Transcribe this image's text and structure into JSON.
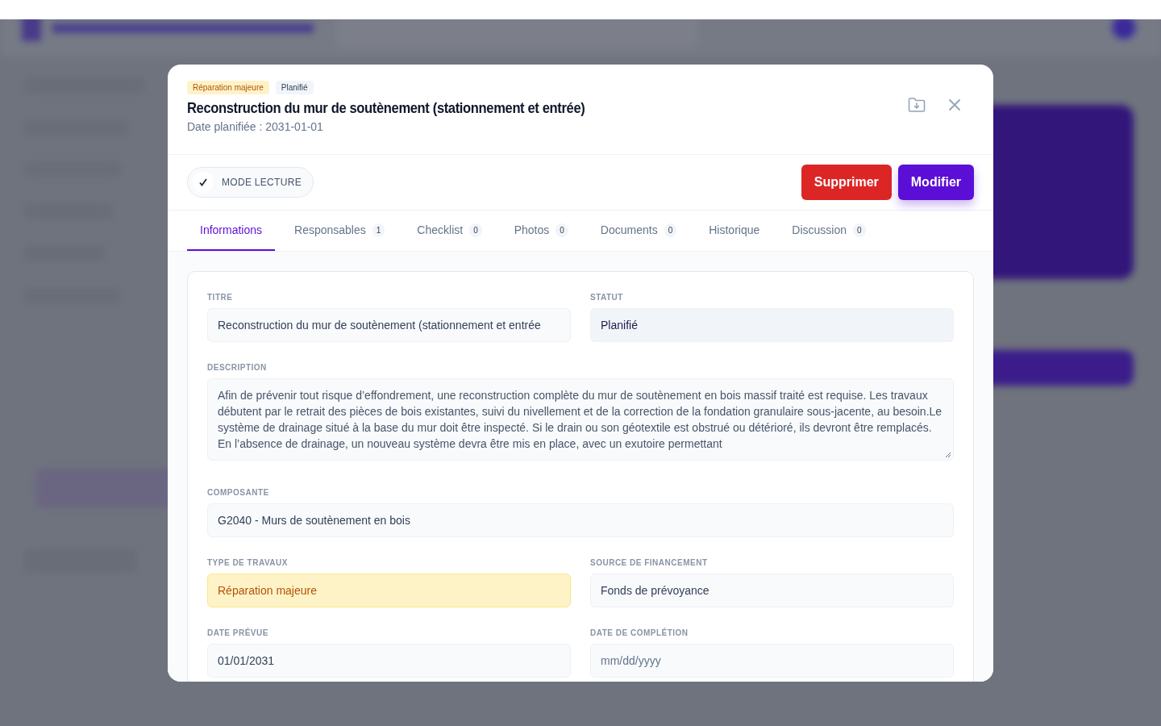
{
  "modal": {
    "badges": [
      {
        "label": "Réparation majeure",
        "kind": "warning"
      },
      {
        "label": "Planifié",
        "kind": "neutral"
      }
    ],
    "title": "Reconstruction du mur de soutènement (stationnement et entrée)",
    "subtitle": "Date planifiée : 2031-01-01",
    "mode_toggle": {
      "label": "MODE LECTURE",
      "checked": true
    },
    "buttons": [
      {
        "label": "Supprimer",
        "kind": "danger"
      },
      {
        "label": "Modifier",
        "kind": "primary"
      }
    ],
    "tabs": [
      {
        "label": "Informations",
        "selected": true
      },
      {
        "label": "Responsables",
        "count": "1",
        "selected": false
      },
      {
        "label": "Checklist",
        "count": "0",
        "selected": false
      },
      {
        "label": "Photos",
        "count": "0",
        "selected": false
      },
      {
        "label": "Documents",
        "count": "0",
        "selected": false
      },
      {
        "label": "Historique",
        "selected": false
      },
      {
        "label": "Discussion",
        "count": "0",
        "selected": false
      }
    ],
    "fields": [
      {
        "label": "TITRE",
        "value": "Reconstruction du mur de soutènement (stationnement et entrée",
        "kind": "text",
        "full_width": false
      },
      {
        "label": "STATUT",
        "value": "Planifié",
        "kind": "select",
        "full_width": false
      },
      {
        "label": "DESCRIPTION",
        "value": "Afin de prévenir tout risque d’effondrement, une reconstruction complète du mur de soutènement en bois massif traité est requise. Les travaux débutent par le retrait des pièces de bois existantes, suivi du nivellement et de la correction de la fondation granulaire sous-jacente, au besoin.Le système de drainage situé à la base du mur doit être inspecté. Si le drain ou son géotextile est obstrué ou détérioré, ils devront être remplacés. En l’absence de drainage, un nouveau système devra être mis en place, avec un exutoire permettant",
        "kind": "textarea",
        "full_width": true
      },
      {
        "label": "COMPOSANTE",
        "value": "G2040 - Murs de soutènement en bois",
        "kind": "text",
        "full_width": true
      },
      {
        "label": "TYPE DE TRAVAUX",
        "value": "Réparation majeure",
        "kind": "warning",
        "full_width": false
      },
      {
        "label": "SOURCE DE FINANCEMENT",
        "value": "Fonds de prévoyance",
        "kind": "text",
        "full_width": false
      },
      {
        "label": "DATE PRÉVUE",
        "value": "01/01/2031",
        "kind": "text",
        "full_width": false
      },
      {
        "label": "DATE DE COMPLÉTION",
        "placeholder": "mm/dd/yyyy",
        "kind": "date",
        "full_width": false
      }
    ]
  }
}
